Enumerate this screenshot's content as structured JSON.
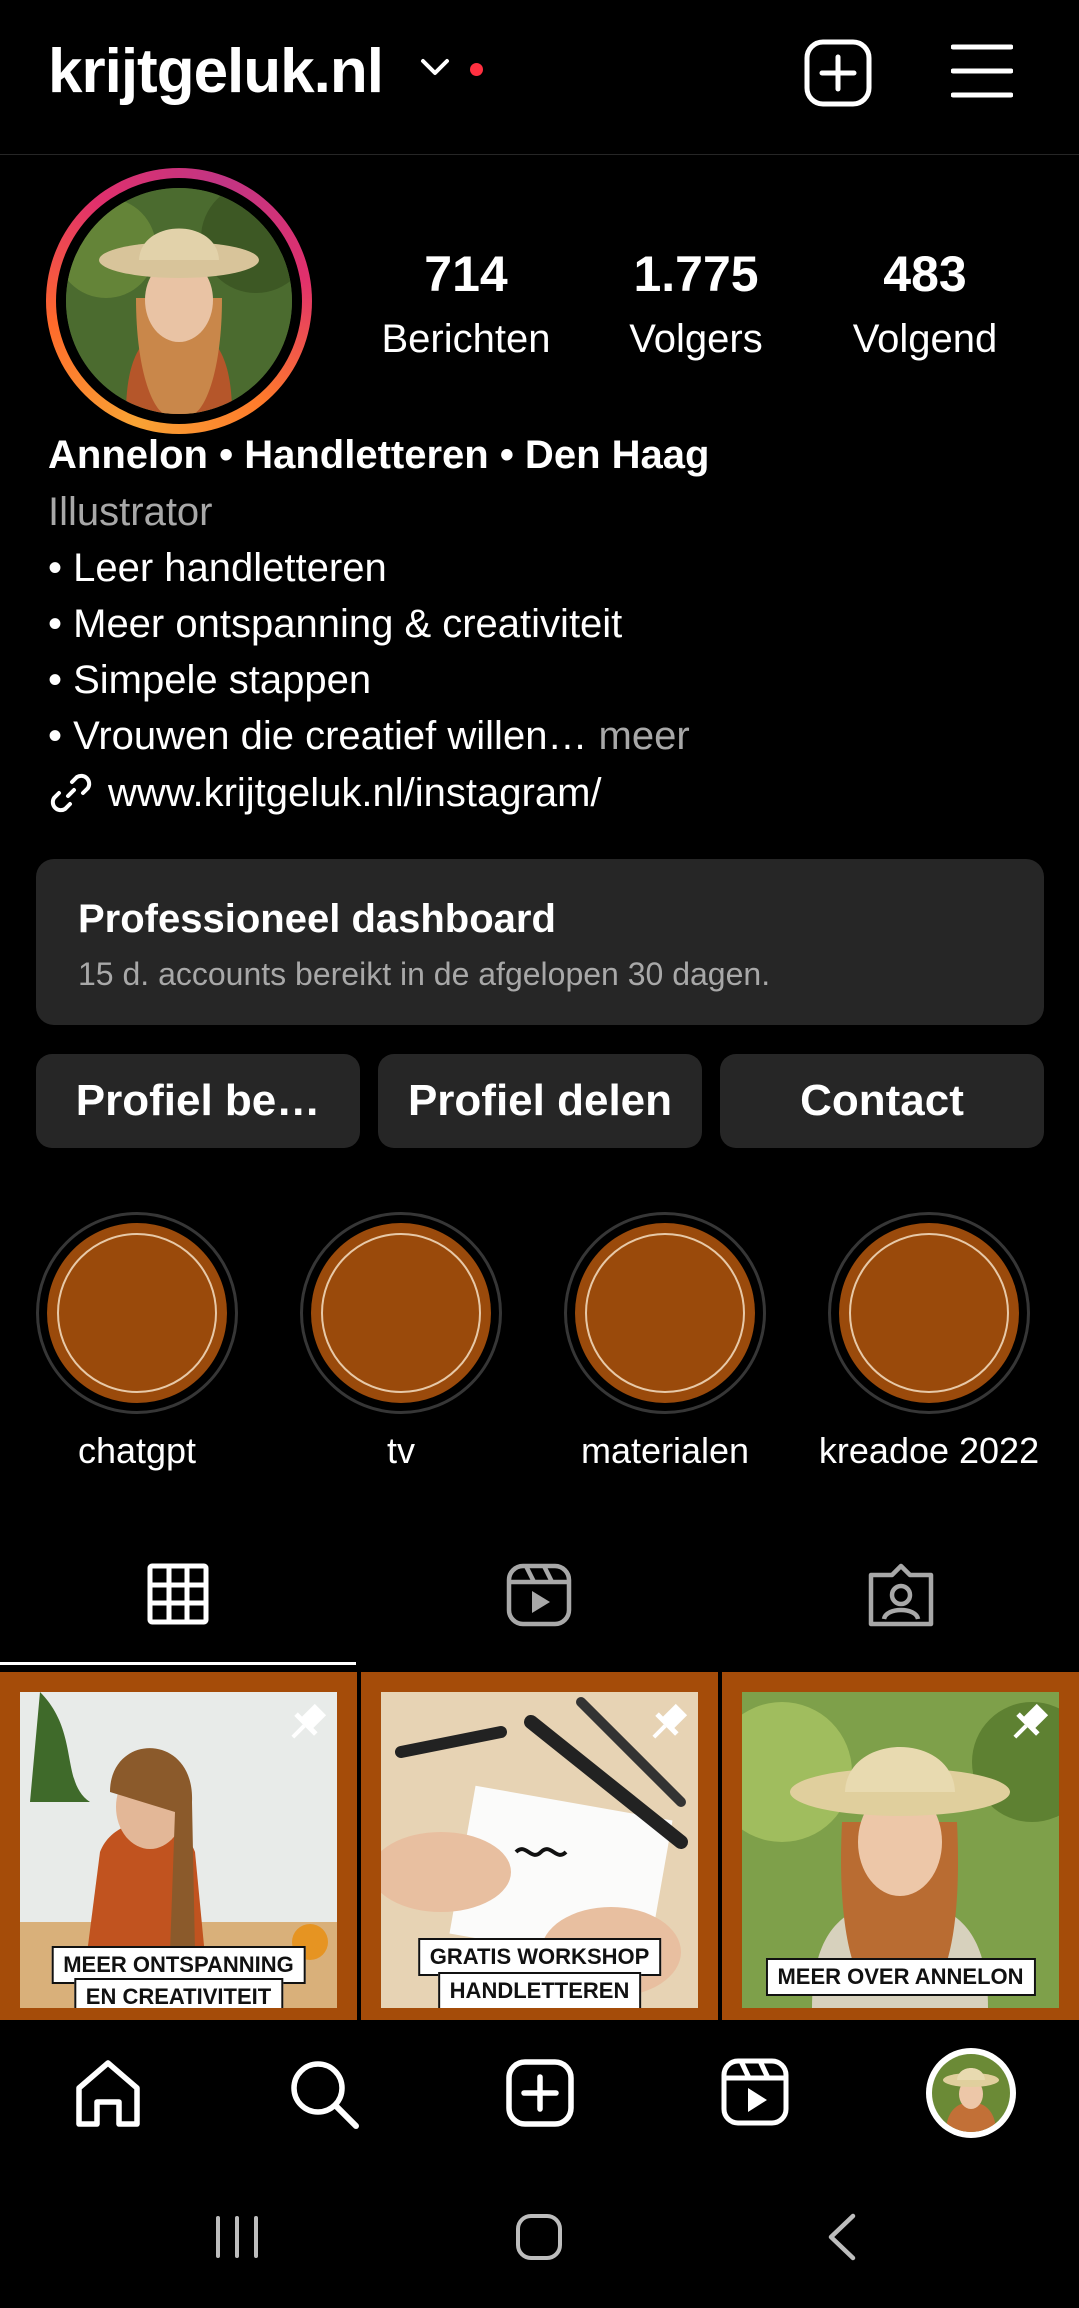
{
  "header": {
    "username": "krijtgeluk.nl"
  },
  "profile": {
    "stats": [
      {
        "count": "714",
        "label": "Berichten"
      },
      {
        "count": "1.775",
        "label": "Volgers"
      },
      {
        "count": "483",
        "label": "Volgend"
      }
    ],
    "name": "Annelon • Handletteren • Den Haag",
    "category": "Illustrator",
    "bio_lines": [
      "• Leer handletteren",
      "• Meer ontspanning & creativiteit",
      "• Simpele stappen",
      "• Vrouwen die creatief willen…"
    ],
    "more_label": " meer",
    "link": "www.krijtgeluk.nl/instagram/"
  },
  "dashboard": {
    "title": "Professioneel dashboard",
    "subtitle": "15 d. accounts bereikt in de afgelopen 30 dagen."
  },
  "buttons": {
    "edit_profile": "Profiel be…",
    "share_profile": "Profiel delen",
    "contact": "Contact"
  },
  "highlights": [
    {
      "label": "chatgpt"
    },
    {
      "label": "tv"
    },
    {
      "label": "materialen"
    },
    {
      "label": "kreadoe 2022"
    }
  ],
  "tabs": [
    "grid-icon",
    "reels-icon",
    "tagged-icon"
  ],
  "posts": [
    {
      "caption_lines": [
        "MEER ONTSPANNING",
        "EN CREATIVITEIT"
      ],
      "pinned": true
    },
    {
      "caption_lines": [
        "GRATIS WORKSHOP",
        "HANDLETTEREN"
      ],
      "pinned": true
    },
    {
      "caption_lines": [
        "MEER OVER ANNELON"
      ],
      "pinned": true
    }
  ],
  "nav": [
    "home-icon",
    "search-icon",
    "create-icon",
    "reels-icon",
    "profile-avatar"
  ],
  "colors": {
    "accent_dot": "#ff3040",
    "highlight_fill": "#9a4a0b",
    "card_bg": "#262626",
    "muted_text": "#a8a8a8"
  }
}
